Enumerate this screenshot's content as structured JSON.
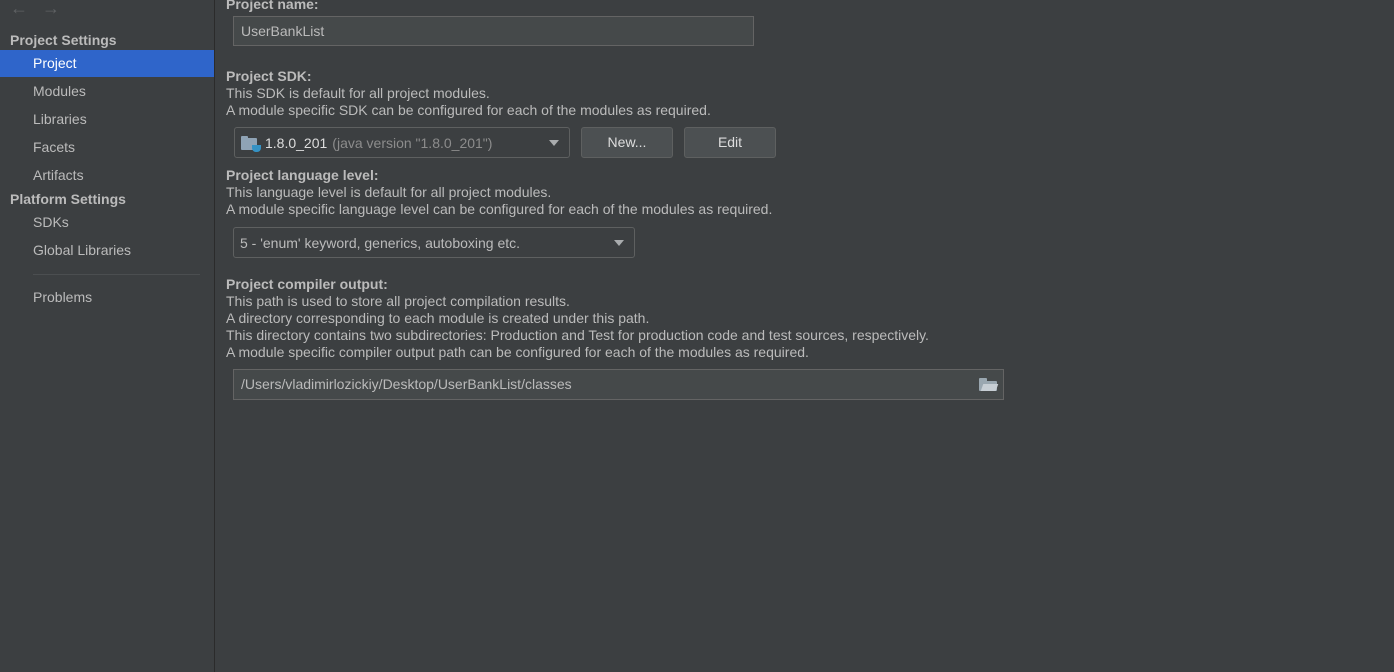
{
  "nav": {
    "back_icon": "←",
    "forward_icon": "→"
  },
  "sidebar": {
    "project_settings_header": "Project Settings",
    "project_items": [
      {
        "label": "Project",
        "selected": true
      },
      {
        "label": "Modules"
      },
      {
        "label": "Libraries"
      },
      {
        "label": "Facets"
      },
      {
        "label": "Artifacts"
      }
    ],
    "platform_settings_header": "Platform Settings",
    "platform_items": [
      {
        "label": "SDKs"
      },
      {
        "label": "Global Libraries"
      }
    ],
    "problems_label": "Problems"
  },
  "project_name": {
    "title": "Project name:",
    "value": "UserBankList"
  },
  "project_sdk": {
    "title": "Project SDK:",
    "desc_line1": "This SDK is default for all project modules.",
    "desc_line2": "A module specific SDK can be configured for each of the modules as required.",
    "selected_version": "1.8.0_201",
    "selected_detail": "(java version \"1.8.0_201\")",
    "new_button": "New...",
    "edit_button": "Edit"
  },
  "language_level": {
    "title": "Project language level:",
    "desc_line1": "This language level is default for all project modules.",
    "desc_line2": "A module specific language level can be configured for each of the modules as required.",
    "selected": "5 - 'enum' keyword, generics, autoboxing etc."
  },
  "compiler_output": {
    "title": "Project compiler output:",
    "desc_line1": "This path is used to store all project compilation results.",
    "desc_line2": "A directory corresponding to each module is created under this path.",
    "desc_line3": "This directory contains two subdirectories: Production and Test for production code and test sources, respectively.",
    "desc_line4": "A module specific compiler output path can be configured for each of the modules as required.",
    "path": "/Users/vladimirlozickiy/Desktop/UserBankList/classes"
  },
  "colors": {
    "background": "#3c3f41",
    "selection": "#2f65ca",
    "text": "#bbbbbb",
    "field_bg": "#45494a"
  }
}
